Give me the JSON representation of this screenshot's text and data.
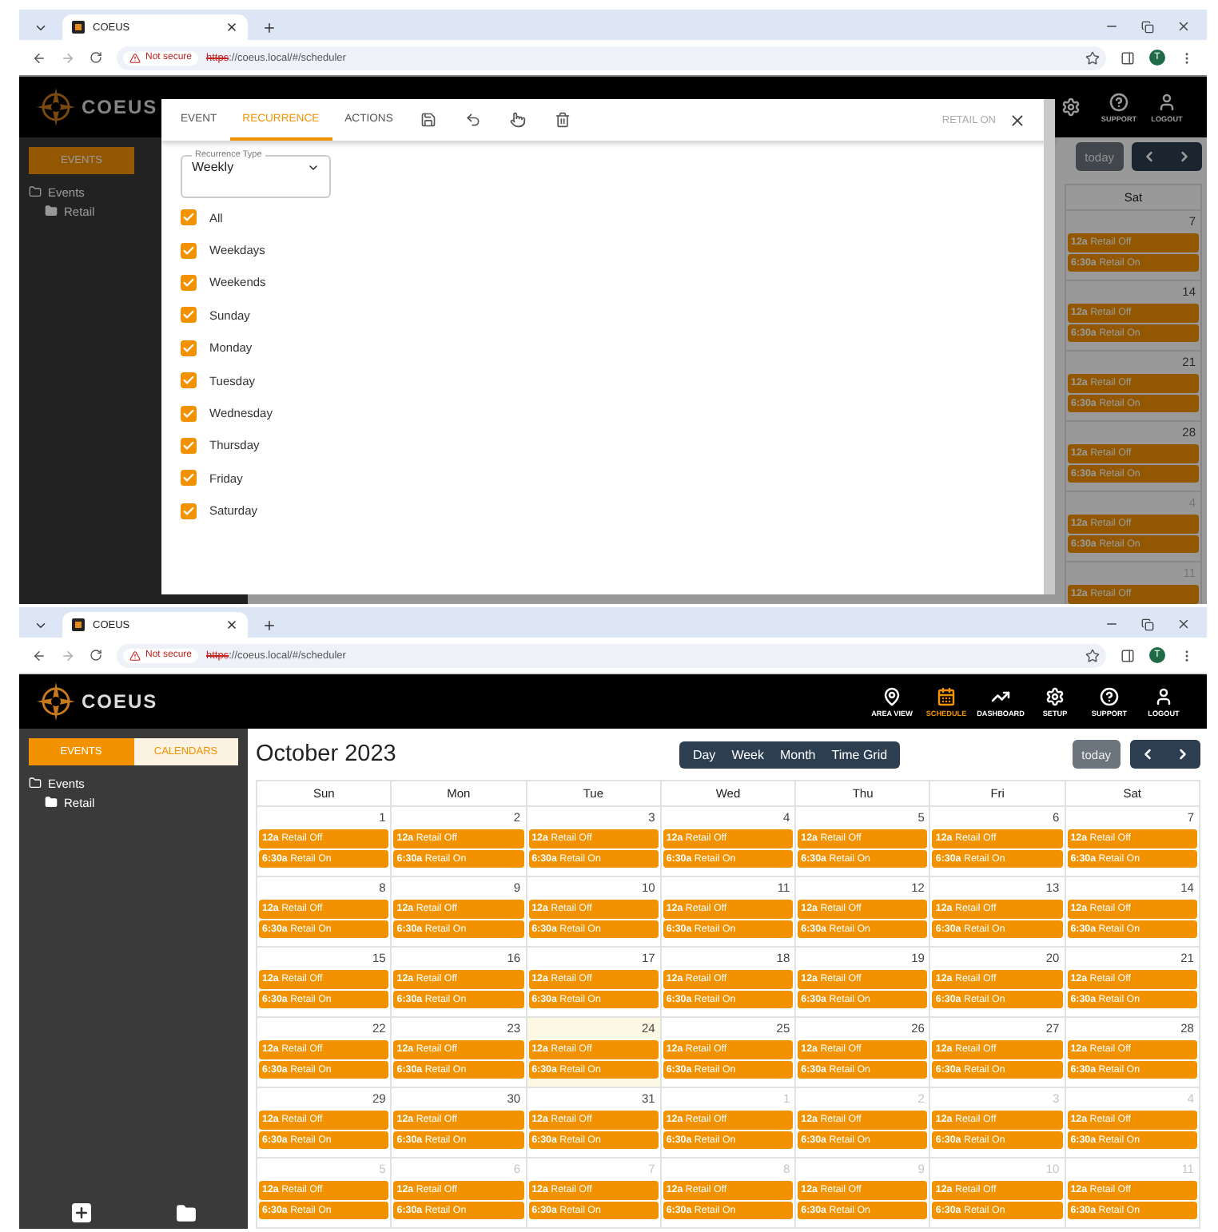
{
  "top_window": {
    "browser": {
      "tab_title": "COEUS",
      "security": "Not secure",
      "url_scheme": "https",
      "url_path": "://coeus.local/#/scheduler",
      "profile_initial": "T"
    },
    "app": {
      "brand": "COEUS",
      "nav": [
        {
          "kind": "setup",
          "selected": false
        },
        {
          "kind": "support",
          "label": "SUPPORT",
          "selected": false
        },
        {
          "kind": "logout",
          "label": "LOGOUT",
          "selected": false
        }
      ],
      "sidebar": {
        "tabs": [
          {
            "label": "EVENTS",
            "selected": true
          }
        ],
        "tree": [
          {
            "label": "Events",
            "children": [
              {
                "label": "Retail"
              }
            ]
          }
        ]
      },
      "today_button": "today",
      "column": {
        "heading": "Sat",
        "days": [
          {
            "date": "7",
            "other_month": false,
            "today": false,
            "events": [
              {
                "time": "12a",
                "title": "Retail Off"
              },
              {
                "time": "6:30a",
                "title": "Retail On"
              }
            ]
          },
          {
            "date": "14",
            "other_month": false,
            "today": false,
            "events": [
              {
                "time": "12a",
                "title": "Retail Off"
              },
              {
                "time": "6:30a",
                "title": "Retail On"
              }
            ]
          },
          {
            "date": "21",
            "other_month": false,
            "today": false,
            "events": [
              {
                "time": "12a",
                "title": "Retail Off"
              },
              {
                "time": "6:30a",
                "title": "Retail On"
              }
            ]
          },
          {
            "date": "28",
            "other_month": false,
            "today": false,
            "events": [
              {
                "time": "12a",
                "title": "Retail Off"
              },
              {
                "time": "6:30a",
                "title": "Retail On"
              }
            ]
          },
          {
            "date": "4",
            "other_month": true,
            "today": false,
            "events": [
              {
                "time": "12a",
                "title": "Retail Off"
              },
              {
                "time": "6:30a",
                "title": "Retail On"
              }
            ]
          },
          {
            "date": "11",
            "other_month": true,
            "today": false,
            "events": [
              {
                "time": "12a",
                "title": "Retail Off"
              }
            ]
          }
        ]
      }
    },
    "dialog": {
      "tabs": [
        {
          "label": "EVENT",
          "selected": false
        },
        {
          "label": "RECURRENCE",
          "selected": true
        },
        {
          "label": "ACTIONS",
          "selected": false
        }
      ],
      "title": "RETAIL ON",
      "recurrence_type": {
        "label": "Recurrence Type",
        "value": "Weekly"
      },
      "options": [
        {
          "label": "All",
          "checked": true
        },
        {
          "label": "Weekdays",
          "checked": true
        },
        {
          "label": "Weekends",
          "checked": true
        },
        {
          "label": "Sunday",
          "checked": true
        },
        {
          "label": "Monday",
          "checked": true
        },
        {
          "label": "Tuesday",
          "checked": true
        },
        {
          "label": "Wednesday",
          "checked": true
        },
        {
          "label": "Thursday",
          "checked": true
        },
        {
          "label": "Friday",
          "checked": true
        },
        {
          "label": "Saturday",
          "checked": true
        }
      ]
    }
  },
  "bottom_window": {
    "browser": {
      "tab_title": "COEUS",
      "security": "Not secure",
      "url_scheme": "https",
      "url_path": "://coeus.local/#/scheduler",
      "profile_initial": "T"
    },
    "app": {
      "brand": "COEUS",
      "nav": [
        {
          "kind": "area",
          "label": "AREA VIEW",
          "selected": false
        },
        {
          "kind": "schedule",
          "label": "SCHEDULE",
          "selected": true
        },
        {
          "kind": "dashboard",
          "label": "DASHBOARD",
          "selected": false
        },
        {
          "kind": "setup",
          "label": "SETUP",
          "selected": false
        },
        {
          "kind": "support",
          "label": "SUPPORT",
          "selected": false
        },
        {
          "kind": "logout",
          "label": "LOGOUT",
          "selected": false
        }
      ],
      "sidebar": {
        "tabs": [
          {
            "label": "EVENTS",
            "selected": true
          },
          {
            "label": "CALENDARS",
            "selected": false
          }
        ],
        "tree": [
          {
            "label": "Events",
            "children": [
              {
                "label": "Retail"
              }
            ]
          }
        ]
      },
      "calendar": {
        "title": "October 2023",
        "views": [
          "Day",
          "Week",
          "Month",
          "Time Grid"
        ],
        "today_button": "today",
        "weekdays": [
          "Sun",
          "Mon",
          "Tue",
          "Wed",
          "Thu",
          "Fri",
          "Sat"
        ],
        "weeks": [
          [
            {
              "date": "1",
              "other_month": false,
              "today": false,
              "events": [
                {
                  "time": "12a",
                  "title": "Retail Off"
                },
                {
                  "time": "6:30a",
                  "title": "Retail On"
                }
              ]
            },
            {
              "date": "2",
              "other_month": false,
              "today": false,
              "events": [
                {
                  "time": "12a",
                  "title": "Retail Off"
                },
                {
                  "time": "6:30a",
                  "title": "Retail On"
                }
              ]
            },
            {
              "date": "3",
              "other_month": false,
              "today": false,
              "events": [
                {
                  "time": "12a",
                  "title": "Retail Off"
                },
                {
                  "time": "6:30a",
                  "title": "Retail On"
                }
              ]
            },
            {
              "date": "4",
              "other_month": false,
              "today": false,
              "events": [
                {
                  "time": "12a",
                  "title": "Retail Off"
                },
                {
                  "time": "6:30a",
                  "title": "Retail On"
                }
              ]
            },
            {
              "date": "5",
              "other_month": false,
              "today": false,
              "events": [
                {
                  "time": "12a",
                  "title": "Retail Off"
                },
                {
                  "time": "6:30a",
                  "title": "Retail On"
                }
              ]
            },
            {
              "date": "6",
              "other_month": false,
              "today": false,
              "events": [
                {
                  "time": "12a",
                  "title": "Retail Off"
                },
                {
                  "time": "6:30a",
                  "title": "Retail On"
                }
              ]
            },
            {
              "date": "7",
              "other_month": false,
              "today": false,
              "events": [
                {
                  "time": "12a",
                  "title": "Retail Off"
                },
                {
                  "time": "6:30a",
                  "title": "Retail On"
                }
              ]
            }
          ],
          [
            {
              "date": "8",
              "other_month": false,
              "today": false,
              "events": [
                {
                  "time": "12a",
                  "title": "Retail Off"
                },
                {
                  "time": "6:30a",
                  "title": "Retail On"
                }
              ]
            },
            {
              "date": "9",
              "other_month": false,
              "today": false,
              "events": [
                {
                  "time": "12a",
                  "title": "Retail Off"
                },
                {
                  "time": "6:30a",
                  "title": "Retail On"
                }
              ]
            },
            {
              "date": "10",
              "other_month": false,
              "today": false,
              "events": [
                {
                  "time": "12a",
                  "title": "Retail Off"
                },
                {
                  "time": "6:30a",
                  "title": "Retail On"
                }
              ]
            },
            {
              "date": "11",
              "other_month": false,
              "today": false,
              "events": [
                {
                  "time": "12a",
                  "title": "Retail Off"
                },
                {
                  "time": "6:30a",
                  "title": "Retail On"
                }
              ]
            },
            {
              "date": "12",
              "other_month": false,
              "today": false,
              "events": [
                {
                  "time": "12a",
                  "title": "Retail Off"
                },
                {
                  "time": "6:30a",
                  "title": "Retail On"
                }
              ]
            },
            {
              "date": "13",
              "other_month": false,
              "today": false,
              "events": [
                {
                  "time": "12a",
                  "title": "Retail Off"
                },
                {
                  "time": "6:30a",
                  "title": "Retail On"
                }
              ]
            },
            {
              "date": "14",
              "other_month": false,
              "today": false,
              "events": [
                {
                  "time": "12a",
                  "title": "Retail Off"
                },
                {
                  "time": "6:30a",
                  "title": "Retail On"
                }
              ]
            }
          ],
          [
            {
              "date": "15",
              "other_month": false,
              "today": false,
              "events": [
                {
                  "time": "12a",
                  "title": "Retail Off"
                },
                {
                  "time": "6:30a",
                  "title": "Retail On"
                }
              ]
            },
            {
              "date": "16",
              "other_month": false,
              "today": false,
              "events": [
                {
                  "time": "12a",
                  "title": "Retail Off"
                },
                {
                  "time": "6:30a",
                  "title": "Retail On"
                }
              ]
            },
            {
              "date": "17",
              "other_month": false,
              "today": false,
              "events": [
                {
                  "time": "12a",
                  "title": "Retail Off"
                },
                {
                  "time": "6:30a",
                  "title": "Retail On"
                }
              ]
            },
            {
              "date": "18",
              "other_month": false,
              "today": false,
              "events": [
                {
                  "time": "12a",
                  "title": "Retail Off"
                },
                {
                  "time": "6:30a",
                  "title": "Retail On"
                }
              ]
            },
            {
              "date": "19",
              "other_month": false,
              "today": false,
              "events": [
                {
                  "time": "12a",
                  "title": "Retail Off"
                },
                {
                  "time": "6:30a",
                  "title": "Retail On"
                }
              ]
            },
            {
              "date": "20",
              "other_month": false,
              "today": false,
              "events": [
                {
                  "time": "12a",
                  "title": "Retail Off"
                },
                {
                  "time": "6:30a",
                  "title": "Retail On"
                }
              ]
            },
            {
              "date": "21",
              "other_month": false,
              "today": false,
              "events": [
                {
                  "time": "12a",
                  "title": "Retail Off"
                },
                {
                  "time": "6:30a",
                  "title": "Retail On"
                }
              ]
            }
          ],
          [
            {
              "date": "22",
              "other_month": false,
              "today": false,
              "events": [
                {
                  "time": "12a",
                  "title": "Retail Off"
                },
                {
                  "time": "6:30a",
                  "title": "Retail On"
                }
              ]
            },
            {
              "date": "23",
              "other_month": false,
              "today": false,
              "events": [
                {
                  "time": "12a",
                  "title": "Retail Off"
                },
                {
                  "time": "6:30a",
                  "title": "Retail On"
                }
              ]
            },
            {
              "date": "24",
              "other_month": false,
              "today": true,
              "events": [
                {
                  "time": "12a",
                  "title": "Retail Off"
                },
                {
                  "time": "6:30a",
                  "title": "Retail On"
                }
              ]
            },
            {
              "date": "25",
              "other_month": false,
              "today": false,
              "events": [
                {
                  "time": "12a",
                  "title": "Retail Off"
                },
                {
                  "time": "6:30a",
                  "title": "Retail On"
                }
              ]
            },
            {
              "date": "26",
              "other_month": false,
              "today": false,
              "events": [
                {
                  "time": "12a",
                  "title": "Retail Off"
                },
                {
                  "time": "6:30a",
                  "title": "Retail On"
                }
              ]
            },
            {
              "date": "27",
              "other_month": false,
              "today": false,
              "events": [
                {
                  "time": "12a",
                  "title": "Retail Off"
                },
                {
                  "time": "6:30a",
                  "title": "Retail On"
                }
              ]
            },
            {
              "date": "28",
              "other_month": false,
              "today": false,
              "events": [
                {
                  "time": "12a",
                  "title": "Retail Off"
                },
                {
                  "time": "6:30a",
                  "title": "Retail On"
                }
              ]
            }
          ],
          [
            {
              "date": "29",
              "other_month": false,
              "today": false,
              "events": [
                {
                  "time": "12a",
                  "title": "Retail Off"
                },
                {
                  "time": "6:30a",
                  "title": "Retail On"
                }
              ]
            },
            {
              "date": "30",
              "other_month": false,
              "today": false,
              "events": [
                {
                  "time": "12a",
                  "title": "Retail Off"
                },
                {
                  "time": "6:30a",
                  "title": "Retail On"
                }
              ]
            },
            {
              "date": "31",
              "other_month": false,
              "today": false,
              "events": [
                {
                  "time": "12a",
                  "title": "Retail Off"
                },
                {
                  "time": "6:30a",
                  "title": "Retail On"
                }
              ]
            },
            {
              "date": "1",
              "other_month": true,
              "today": false,
              "events": [
                {
                  "time": "12a",
                  "title": "Retail Off"
                },
                {
                  "time": "6:30a",
                  "title": "Retail On"
                }
              ]
            },
            {
              "date": "2",
              "other_month": true,
              "today": false,
              "events": [
                {
                  "time": "12a",
                  "title": "Retail Off"
                },
                {
                  "time": "6:30a",
                  "title": "Retail On"
                }
              ]
            },
            {
              "date": "3",
              "other_month": true,
              "today": false,
              "events": [
                {
                  "time": "12a",
                  "title": "Retail Off"
                },
                {
                  "time": "6:30a",
                  "title": "Retail On"
                }
              ]
            },
            {
              "date": "4",
              "other_month": true,
              "today": false,
              "events": [
                {
                  "time": "12a",
                  "title": "Retail Off"
                },
                {
                  "time": "6:30a",
                  "title": "Retail On"
                }
              ]
            }
          ],
          [
            {
              "date": "5",
              "other_month": true,
              "today": false,
              "events": [
                {
                  "time": "12a",
                  "title": "Retail Off"
                },
                {
                  "time": "6:30a",
                  "title": "Retail On"
                }
              ]
            },
            {
              "date": "6",
              "other_month": true,
              "today": false,
              "events": [
                {
                  "time": "12a",
                  "title": "Retail Off"
                },
                {
                  "time": "6:30a",
                  "title": "Retail On"
                }
              ]
            },
            {
              "date": "7",
              "other_month": true,
              "today": false,
              "events": [
                {
                  "time": "12a",
                  "title": "Retail Off"
                },
                {
                  "time": "6:30a",
                  "title": "Retail On"
                }
              ]
            },
            {
              "date": "8",
              "other_month": true,
              "today": false,
              "events": [
                {
                  "time": "12a",
                  "title": "Retail Off"
                },
                {
                  "time": "6:30a",
                  "title": "Retail On"
                }
              ]
            },
            {
              "date": "9",
              "other_month": true,
              "today": false,
              "events": [
                {
                  "time": "12a",
                  "title": "Retail Off"
                },
                {
                  "time": "6:30a",
                  "title": "Retail On"
                }
              ]
            },
            {
              "date": "10",
              "other_month": true,
              "today": false,
              "events": [
                {
                  "time": "12a",
                  "title": "Retail Off"
                },
                {
                  "time": "6:30a",
                  "title": "Retail On"
                }
              ]
            },
            {
              "date": "11",
              "other_month": true,
              "today": false,
              "events": [
                {
                  "time": "12a",
                  "title": "Retail Off"
                },
                {
                  "time": "6:30a",
                  "title": "Retail On"
                }
              ]
            }
          ]
        ]
      }
    }
  }
}
